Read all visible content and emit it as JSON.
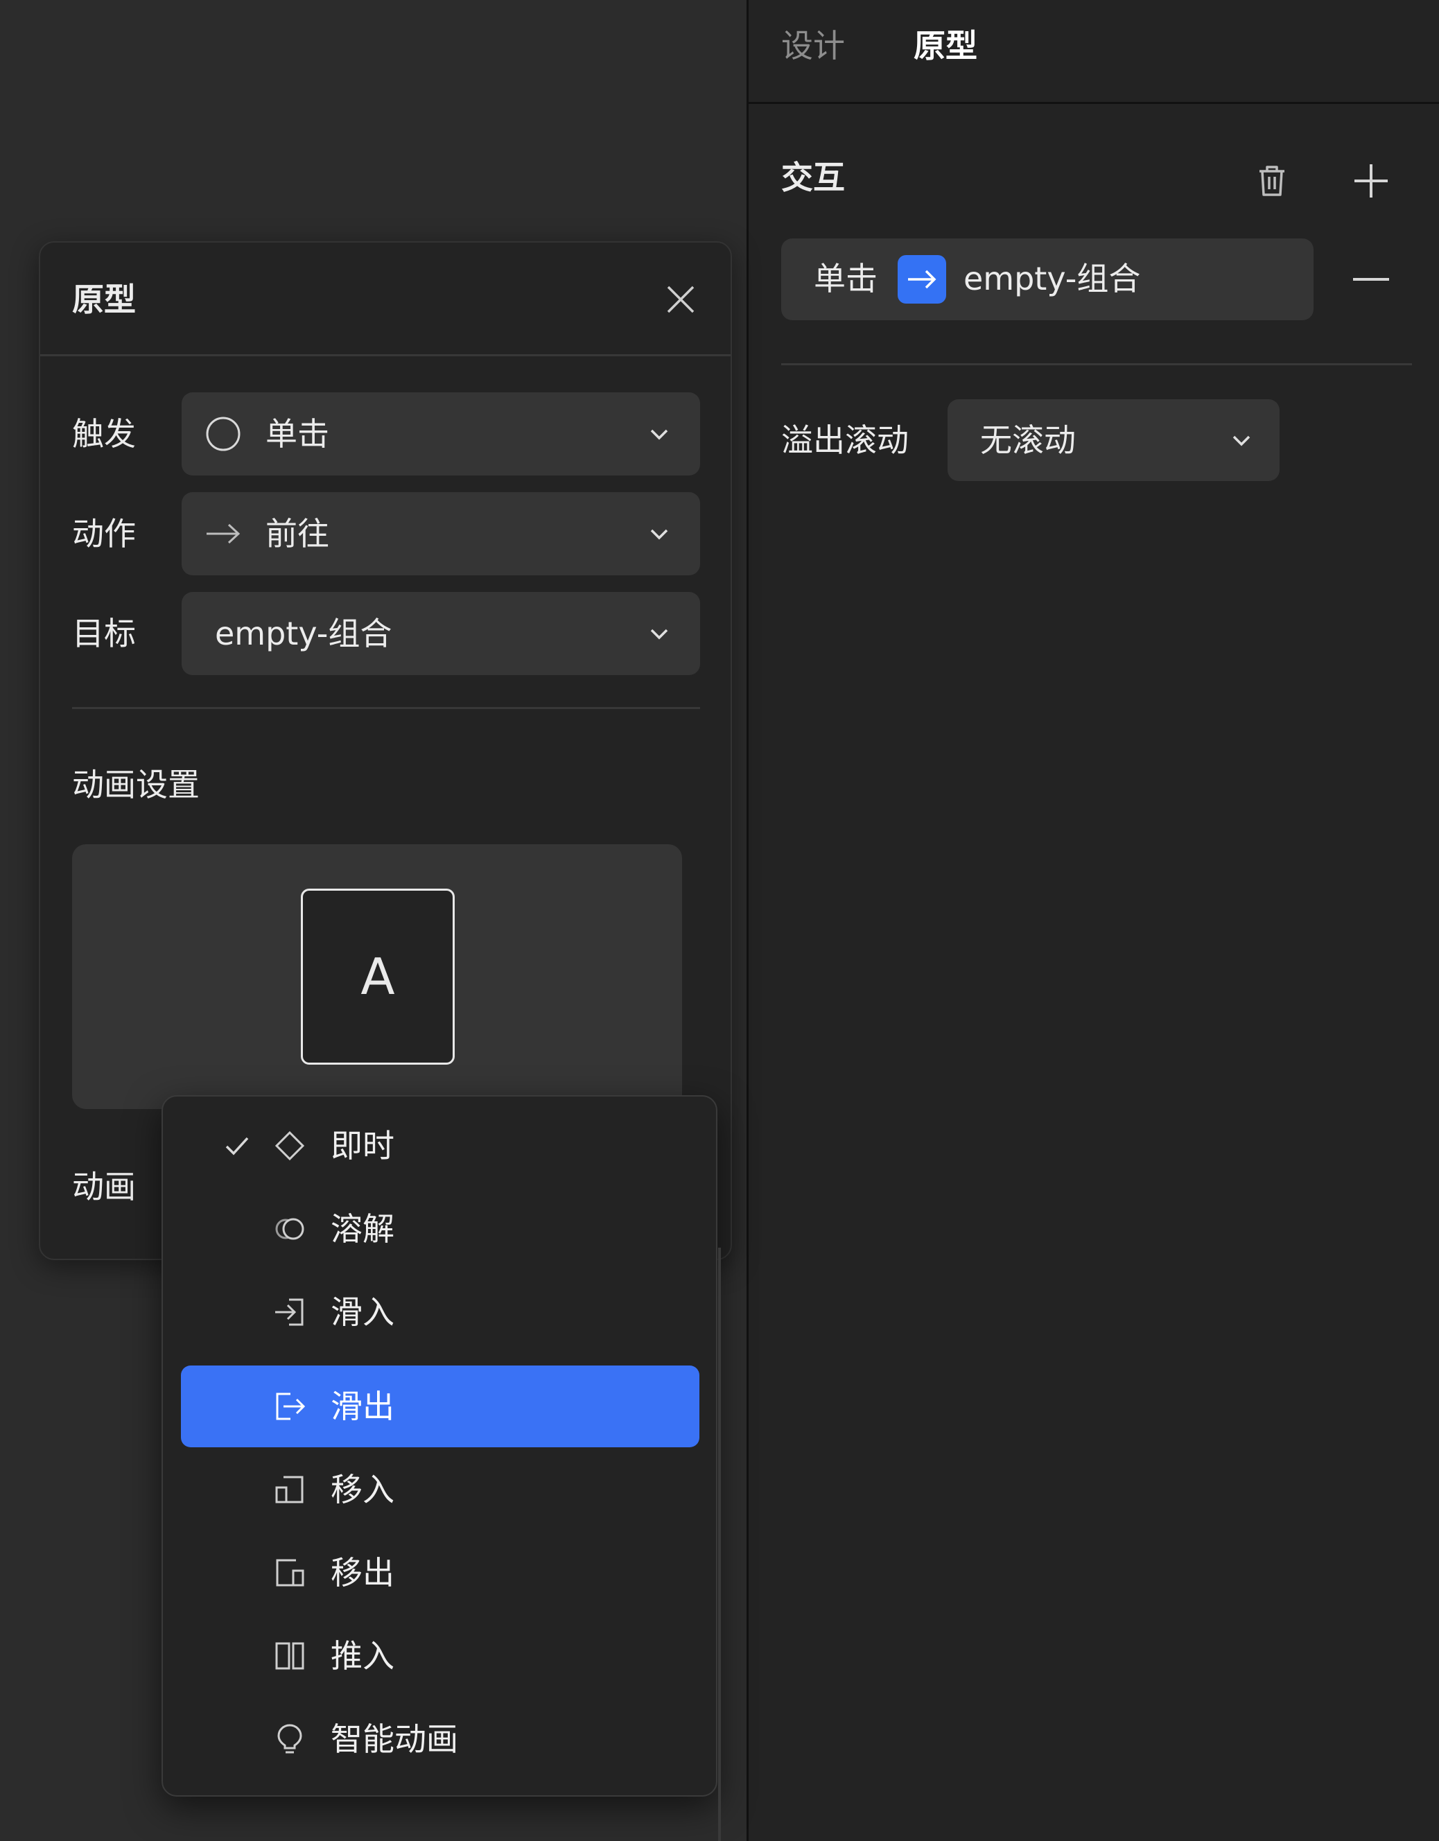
{
  "right_panel": {
    "tabs": [
      "设计",
      "原型"
    ],
    "active_tab": "原型",
    "section_title": "交互",
    "interaction": {
      "trigger": "单击",
      "target": "empty-组合"
    },
    "overflow": {
      "label": "溢出滚动",
      "value": "无滚动"
    }
  },
  "prototype_dialog": {
    "title": "原型",
    "trigger": {
      "label": "触发",
      "value": "单击"
    },
    "action": {
      "label": "动作",
      "value": "前往"
    },
    "target": {
      "label": "目标",
      "value": "empty-组合"
    },
    "animation_section_title": "动画设置",
    "preview_letter": "A",
    "animation_label": "动画"
  },
  "animation_menu": {
    "selected": "即时",
    "highlighted": "滑出",
    "items": [
      {
        "label": "即时",
        "icon": "diamond-icon"
      },
      {
        "label": "溶解",
        "icon": "dissolve-icon"
      },
      {
        "label": "滑入",
        "icon": "slide-in-icon"
      },
      {
        "label": "滑出",
        "icon": "slide-out-icon"
      },
      {
        "label": "移入",
        "icon": "move-in-icon"
      },
      {
        "label": "移出",
        "icon": "move-out-icon"
      },
      {
        "label": "推入",
        "icon": "push-icon"
      },
      {
        "label": "智能动画",
        "icon": "smart-animate-icon"
      }
    ]
  },
  "colors": {
    "accent": "#3a72f5",
    "panel_bg": "#232323",
    "canvas_bg": "#2c2c2c",
    "field_bg": "#353535"
  }
}
